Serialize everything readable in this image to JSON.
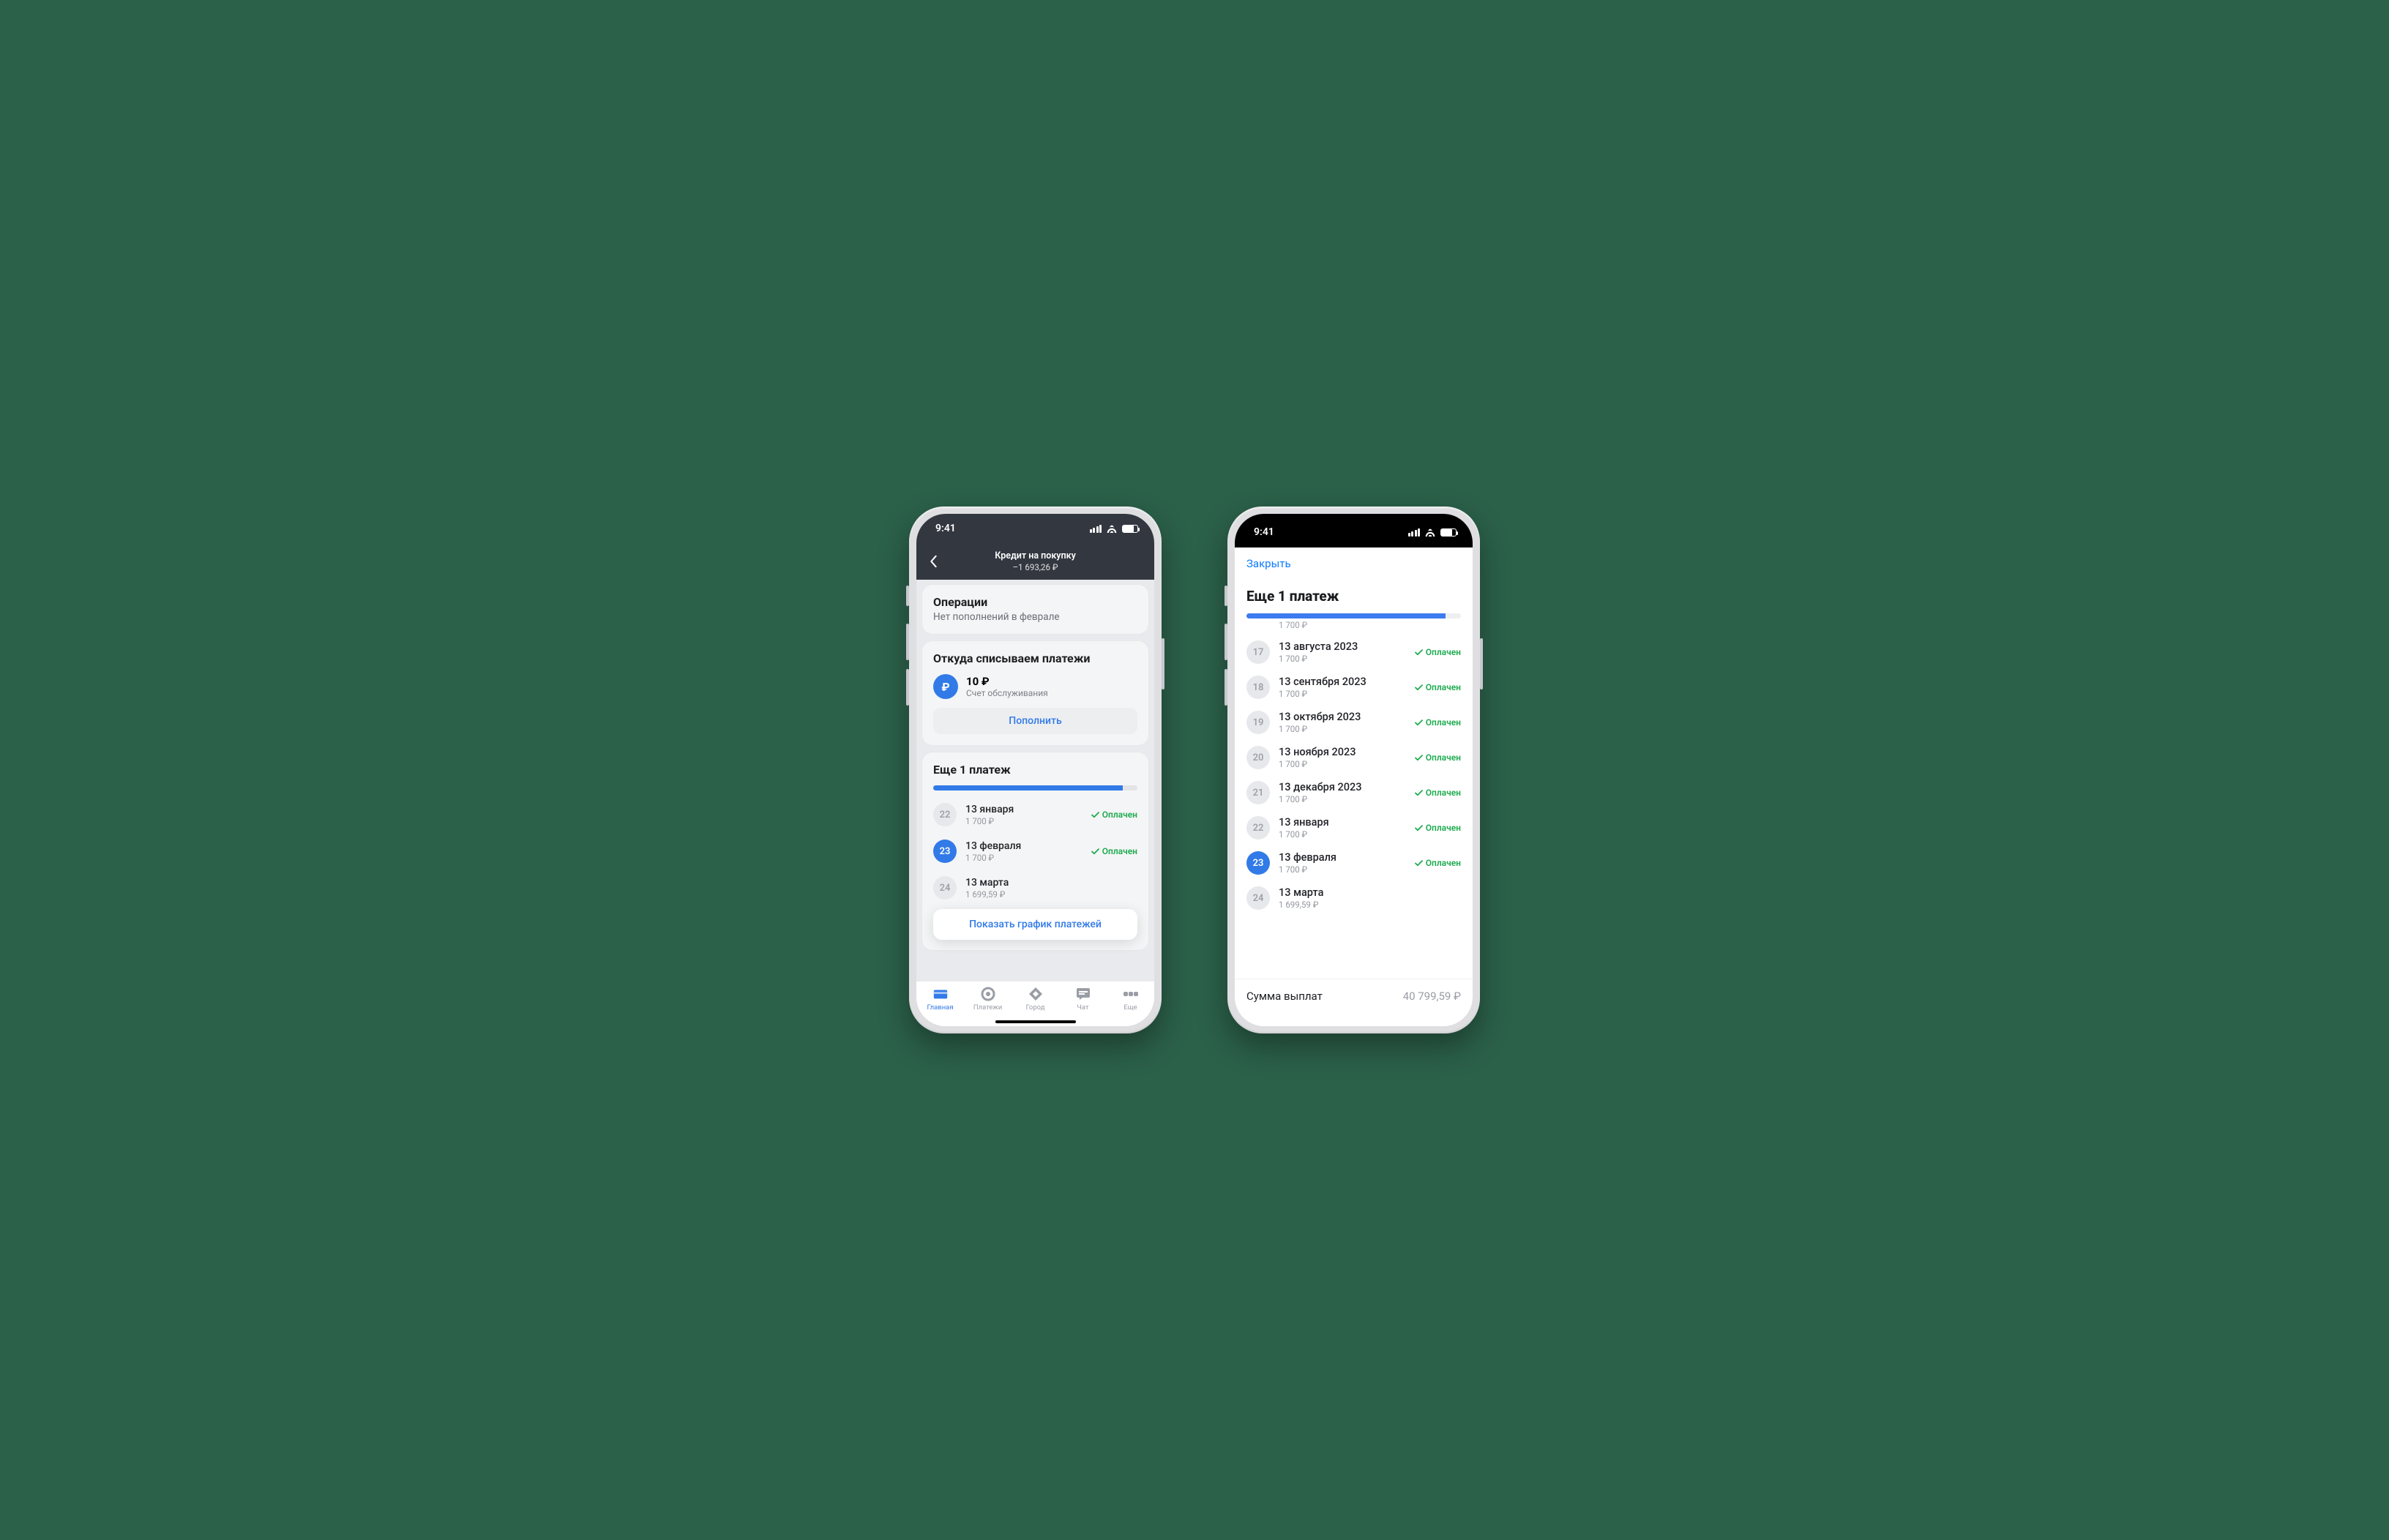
{
  "status": {
    "time": "9:41"
  },
  "phoneA": {
    "nav": {
      "title": "Кредит на покупку",
      "subtitle": "–1 693,26 ₽"
    },
    "ops": {
      "title": "Операции",
      "subtitle": "Нет пополнений в феврале"
    },
    "source": {
      "title": "Откуда списываем платежи",
      "amount": "10 ₽",
      "account": "Счет обслуживания",
      "topup": "Пополнить"
    },
    "sched": {
      "title": "Еще 1 платеж",
      "progress_pct": 93,
      "items": [
        {
          "idx": "22",
          "active": false,
          "date": "13 января",
          "amount": "1 700 ₽",
          "paid": true
        },
        {
          "idx": "23",
          "active": true,
          "date": "13 февраля",
          "amount": "1 700 ₽",
          "paid": true
        },
        {
          "idx": "24",
          "active": false,
          "date": "13 марта",
          "amount": "1 699,59 ₽",
          "paid": false
        }
      ],
      "show_all": "Показать график платежей"
    },
    "tabs": {
      "home": "Главная",
      "payments": "Платежи",
      "city": "Город",
      "chat": "Чат",
      "more": "Еще"
    }
  },
  "phoneB": {
    "close": "Закрыть",
    "title": "Еще 1 платеж",
    "progress_pct": 93,
    "partial_first_amount": "1 700 ₽",
    "items": [
      {
        "idx": "17",
        "active": false,
        "date": "13 августа 2023",
        "amount": "1 700 ₽",
        "paid": true
      },
      {
        "idx": "18",
        "active": false,
        "date": "13 сентября 2023",
        "amount": "1 700 ₽",
        "paid": true
      },
      {
        "idx": "19",
        "active": false,
        "date": "13 октября 2023",
        "amount": "1 700 ₽",
        "paid": true
      },
      {
        "idx": "20",
        "active": false,
        "date": "13 ноября 2023",
        "amount": "1 700 ₽",
        "paid": true
      },
      {
        "idx": "21",
        "active": false,
        "date": "13 декабря 2023",
        "amount": "1 700 ₽",
        "paid": true
      },
      {
        "idx": "22",
        "active": false,
        "date": "13 января",
        "amount": "1 700 ₽",
        "paid": true
      },
      {
        "idx": "23",
        "active": true,
        "date": "13 февраля",
        "amount": "1 700 ₽",
        "paid": true
      },
      {
        "idx": "24",
        "active": false,
        "date": "13 марта",
        "amount": "1 699,59 ₽",
        "paid": false
      }
    ],
    "paid_label": "Оплачен",
    "total_label": "Сумма выплат",
    "total_value": "40 799,59 ₽"
  }
}
